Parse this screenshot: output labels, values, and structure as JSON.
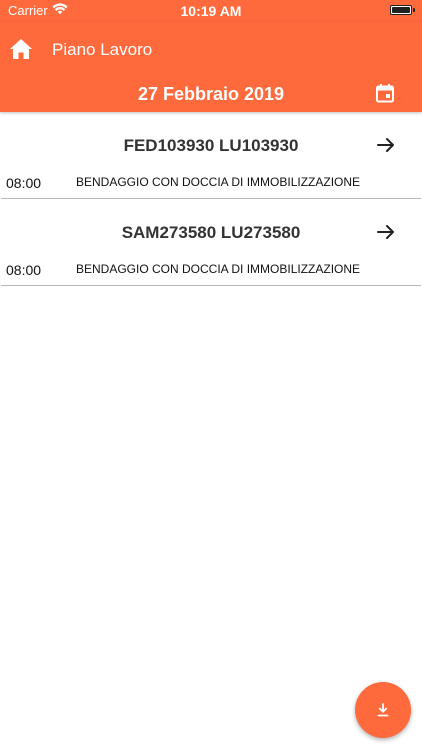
{
  "status_bar": {
    "carrier": "Carrier",
    "time": "10:19 AM"
  },
  "header": {
    "title": "Piano Lavoro",
    "date": "27 Febbraio 2019"
  },
  "items": [
    {
      "code": "FED103930 LU103930",
      "time": "08:00",
      "description": "BENDAGGIO CON DOCCIA DI IMMOBILIZZAZIONE"
    },
    {
      "code": "SAM273580 LU273580",
      "time": "08:00",
      "description": "BENDAGGIO CON DOCCIA DI IMMOBILIZZAZIONE"
    }
  ],
  "icons": {
    "home": "home-icon",
    "calendar": "calendar-icon",
    "arrow": "arrow-right-icon",
    "download": "download-icon",
    "wifi": "wifi-icon",
    "battery": "battery-icon"
  },
  "colors": {
    "accent": "#ff6a3d",
    "header_text": "#ffffff",
    "divider": "#b8b8b8"
  }
}
